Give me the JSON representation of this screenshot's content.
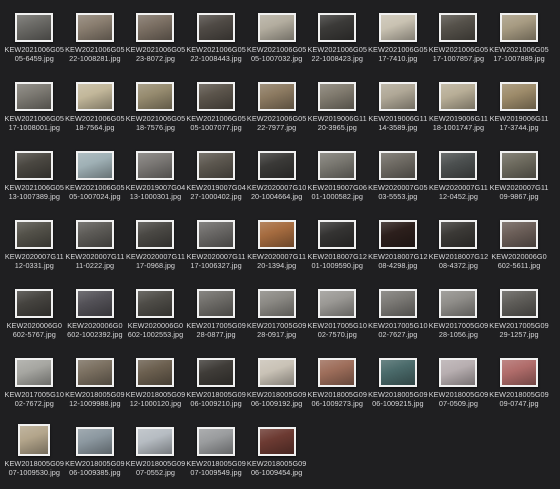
{
  "window": {
    "background": "#1f1f21"
  },
  "files": [
    {
      "name": "KEW20210606G0505-6459.jpg",
      "line1": "KEW2021006G05",
      "line2": "05-6459.jpg",
      "shape": "landscape",
      "tone": "#6b6a66"
    },
    {
      "name": "KEW20210606G0522-1008281.jpg",
      "line1": "KEW2021006G05",
      "line2": "22-1008281.jpg",
      "shape": "landscape",
      "tone": "#8a7e70"
    },
    {
      "name": "KEW20210606G0523-8072.jpg",
      "line1": "KEW2021006G05",
      "line2": "23-8072.jpg",
      "shape": "landscape",
      "tone": "#7c7064"
    },
    {
      "name": "KEW20210606G0522-1008443.jpg",
      "line1": "KEW2021006G05",
      "line2": "22-1008443.jpg",
      "shape": "landscape",
      "tone": "#4f4a45"
    },
    {
      "name": "KEW20210606G0505-1007032.jpg",
      "line1": "KEW2021006G05",
      "line2": "05-1007032.jpg",
      "shape": "landscape",
      "tone": "#b3ad9f"
    },
    {
      "name": "KEW20210606G0522-1008423.jpg",
      "line1": "KEW2021006G05",
      "line2": "22-1008423.jpg",
      "shape": "landscape",
      "tone": "#3b3a38"
    },
    {
      "name": "KEW20210606G0517-7410.jpg",
      "line1": "KEW2021006G05",
      "line2": "17-7410.jpg",
      "shape": "landscape",
      "tone": "#c9c2b2"
    },
    {
      "name": "KEW20210606G0517-1007857.jpg",
      "line1": "KEW2021006G05",
      "line2": "17-1007857.jpg",
      "shape": "landscape",
      "tone": "#55514a"
    },
    {
      "name": "KEW20210606G0517-1007889.jpg",
      "line1": "KEW2021006G05",
      "line2": "17-1007889.jpg",
      "shape": "landscape",
      "tone": "#a79b82"
    },
    {
      "name": "KEW20210606G0517-1008001.jpg",
      "line1": "KEW2021006G05",
      "line2": "17-1008001.jpg",
      "shape": "landscape",
      "tone": "#7d7a73"
    },
    {
      "name": "KEW20210606G0518-7564.jpg",
      "line1": "KEW2021006G05",
      "line2": "18-7564.jpg",
      "shape": "landscape",
      "tone": "#c2b79a"
    },
    {
      "name": "KEW20210606G0518-7576.jpg",
      "line1": "KEW2021006G05",
      "line2": "18-7576.jpg",
      "shape": "landscape",
      "tone": "#968b6f"
    },
    {
      "name": "KEW20210606G0505-1007077.jpg",
      "line1": "KEW2021006G05",
      "line2": "05-1007077.jpg",
      "shape": "landscape",
      "tone": "#5b544b"
    },
    {
      "name": "KEW20210606G0522-7977.jpg",
      "line1": "KEW2021006G05",
      "line2": "22-7977.jpg",
      "shape": "landscape",
      "tone": "#8c7a61"
    },
    {
      "name": "KEW20190606G1120-3965.jpg",
      "line1": "KEW2019006G11",
      "line2": "20-3965.jpg",
      "shape": "landscape",
      "tone": "#817b6f"
    },
    {
      "name": "KEW20190606G1114-3589.jpg",
      "line1": "KEW2019006G11",
      "line2": "14-3589.jpg",
      "shape": "landscape",
      "tone": "#b0a897"
    },
    {
      "name": "KEW20190606G1118-1001747.jpg",
      "line1": "KEW2019006G11",
      "line2": "18-1001747.jpg",
      "shape": "landscape",
      "tone": "#b8ae97"
    },
    {
      "name": "KEW20190606G1117-3744.jpg",
      "line1": "KEW2019006G11",
      "line2": "17-3744.jpg",
      "shape": "landscape",
      "tone": "#9d8b6a"
    },
    {
      "name": "KEW20210606G0513-1007389.jpg",
      "line1": "KEW2021006G05",
      "line2": "13-1007389.jpg",
      "shape": "landscape",
      "tone": "#4a4741"
    },
    {
      "name": "KEW20210606G0505-1007024.jpg",
      "line1": "KEW2021006G05",
      "line2": "05-1007024.jpg",
      "shape": "landscape",
      "tone": "#9fb0b5"
    },
    {
      "name": "KEW20190070G0413-1000301.jpg",
      "line1": "KEW2019007G04",
      "line2": "13-1000301.jpg",
      "shape": "landscape",
      "tone": "#7b7875"
    },
    {
      "name": "KEW20190070G0427-1000402.jpg",
      "line1": "KEW2019007G04",
      "line2": "27-1000402.jpg",
      "shape": "landscape",
      "tone": "#5c574f"
    },
    {
      "name": "KEW20200070G1020-1004664.jpg",
      "line1": "KEW2020007G10",
      "line2": "20-1004664.jpg",
      "shape": "landscape",
      "tone": "#3a3937"
    },
    {
      "name": "KEW20190070G0601-1000582.jpg",
      "line1": "KEW2019007G06",
      "line2": "01-1000582.jpg",
      "shape": "landscape",
      "tone": "#7a7871"
    },
    {
      "name": "KEW20200070G0503-5553.jpg",
      "line1": "KEW2020007G05",
      "line2": "03-5553.jpg",
      "shape": "landscape",
      "tone": "#6e6a63"
    },
    {
      "name": "KEW20200070G1112-0452.jpg",
      "line1": "KEW2020007G11",
      "line2": "12-0452.jpg",
      "shape": "landscape",
      "tone": "#4c5050"
    },
    {
      "name": "KEW20200070G1109-9867.jpg",
      "line1": "KEW2020007G11",
      "line2": "09-9867.jpg",
      "shape": "landscape",
      "tone": "#6d6a5e"
    },
    {
      "name": "KEW20200070G1112-0331.jpg",
      "line1": "KEW2020007G11",
      "line2": "12-0331.jpg",
      "shape": "landscape",
      "tone": "#535149"
    },
    {
      "name": "KEW20200070G1111-0222.jpg",
      "line1": "KEW2020007G11",
      "line2": "11-0222.jpg",
      "shape": "landscape",
      "tone": "#5d5b57"
    },
    {
      "name": "KEW20200070G1117-0968.jpg",
      "line1": "KEW2020007G11",
      "line2": "17-0968.jpg",
      "shape": "landscape",
      "tone": "#4a4844"
    },
    {
      "name": "KEW20200070G1117-1006327.jpg",
      "line1": "KEW2020007G11",
      "line2": "17-1006327.jpg",
      "shape": "landscape",
      "tone": "#6a6866"
    },
    {
      "name": "KEW20200070G1120-1394.jpg",
      "line1": "KEW2020007G11",
      "line2": "20-1394.jpg",
      "shape": "landscape",
      "tone": "#a56b3f"
    },
    {
      "name": "KEW20180070G1201-1009590.jpg",
      "line1": "KEW2018007G12",
      "line2": "01-1009590.jpg",
      "shape": "landscape",
      "tone": "#343332"
    },
    {
      "name": "KEW20180070G1208-4298.jpg",
      "line1": "KEW2018007G12",
      "line2": "08-4298.jpg",
      "shape": "landscape",
      "tone": "#2c1f1c"
    },
    {
      "name": "KEW20180070G1208-4372.jpg",
      "line1": "KEW2018007G12",
      "line2": "08-4372.jpg",
      "shape": "landscape",
      "tone": "#3b3936"
    },
    {
      "name": "KEW20200060G0602-5611.jpg",
      "line1": "KEW2020006G0",
      "line2": "602-5611.jpg",
      "shape": "landscape",
      "tone": "#6b5e58"
    },
    {
      "name": "KEW20200060G0602-5767.jpg",
      "line1": "KEW2020006G0",
      "line2": "602-5767.jpg",
      "shape": "landscape",
      "tone": "#45433f"
    },
    {
      "name": "KEW20200060G0602-1002392.jpg",
      "line1": "KEW2020006G0",
      "line2": "602-1002392.jpg",
      "shape": "landscape",
      "tone": "#535157"
    },
    {
      "name": "KEW20200060G0602-1002553.jpg",
      "line1": "KEW2020006G0",
      "line2": "602-1002553.jpg",
      "shape": "landscape",
      "tone": "#4e4c47"
    },
    {
      "name": "KEW20170050G0928-0877.jpg",
      "line1": "KEW2017005G09",
      "line2": "28-0877.jpg",
      "shape": "landscape",
      "tone": "#6e6c68"
    },
    {
      "name": "KEW20170050G0928-0917.jpg",
      "line1": "KEW2017005G09",
      "line2": "28-0917.jpg",
      "shape": "landscape",
      "tone": "#8a8883"
    },
    {
      "name": "KEW20170050G1002-7570.jpg",
      "line1": "KEW2017005G10",
      "line2": "02-7570.jpg",
      "shape": "landscape",
      "tone": "#9a9894"
    },
    {
      "name": "KEW20170050G1002-7627.jpg",
      "line1": "KEW2017005G10",
      "line2": "02-7627.jpg",
      "shape": "landscape",
      "tone": "#7a7874"
    },
    {
      "name": "KEW20170050G0928-1056.jpg",
      "line1": "KEW2017005G09",
      "line2": "28-1056.jpg",
      "shape": "landscape",
      "tone": "#8f8d89"
    },
    {
      "name": "KEW20170050G0929-1257.jpg",
      "line1": "KEW2017005G09",
      "line2": "29-1257.jpg",
      "shape": "landscape",
      "tone": "#5f5d59"
    },
    {
      "name": "KEW20170050G1002-7672.jpg",
      "line1": "KEW2017005G10",
      "line2": "02-7672.jpg",
      "shape": "landscape",
      "tone": "#a6a6a1"
    },
    {
      "name": "KEW20180050G0912-1009988.jpg",
      "line1": "KEW2018005G09",
      "line2": "12-1009988.jpg",
      "shape": "landscape",
      "tone": "#7a6f60"
    },
    {
      "name": "KEW20180050G0912-1000120.jpg",
      "line1": "KEW2018005G09",
      "line2": "12-1000120.jpg",
      "shape": "landscape",
      "tone": "#6b5f4f"
    },
    {
      "name": "KEW20180050G0906-1009210.jpg",
      "line1": "KEW2018005G09",
      "line2": "06-1009210.jpg",
      "shape": "landscape",
      "tone": "#3f3c38"
    },
    {
      "name": "KEW20180050G0906-1009192.jpg",
      "line1": "KEW2018005G09",
      "line2": "06-1009192.jpg",
      "shape": "landscape",
      "tone": "#c9c2b6"
    },
    {
      "name": "KEW20180050G0906-1009273.jpg",
      "line1": "KEW2018005G09",
      "line2": "06-1009273.jpg",
      "shape": "landscape",
      "tone": "#9d6d5a"
    },
    {
      "name": "KEW20180050G0906-1009215.jpg",
      "line1": "KEW2018005G09",
      "line2": "06-1009215.jpg",
      "shape": "landscape",
      "tone": "#4a6a6a"
    },
    {
      "name": "KEW20180050G0907-0509.jpg",
      "line1": "KEW2018005G09",
      "line2": "07-0509.jpg",
      "shape": "landscape",
      "tone": "#b7aeb0"
    },
    {
      "name": "KEW20180050G0909-0747.jpg",
      "line1": "KEW2018005G09",
      "line2": "09-0747.jpg",
      "shape": "landscape",
      "tone": "#b06c6a"
    },
    {
      "name": "KEW20180050G0907-1009530.jpg",
      "line1": "KEW2018005G09",
      "line2": "07-1009530.jpg",
      "shape": "square",
      "tone": "#b3a58b"
    },
    {
      "name": "KEW20180050G0906-1009385.jpg",
      "line1": "KEW2018005G09",
      "line2": "06-1009385.jpg",
      "shape": "landscape",
      "tone": "#8c98a0"
    },
    {
      "name": "KEW20180050G0907-0552.jpg",
      "line1": "KEW2018005G09",
      "line2": "07-0552.jpg",
      "shape": "landscape",
      "tone": "#b6bcc2"
    },
    {
      "name": "KEW20180050G0907-1009549.jpg",
      "line1": "KEW2018005G09",
      "line2": "07-1009549.jpg",
      "shape": "landscape",
      "tone": "#9a9c9e"
    },
    {
      "name": "KEW20180050G0906-1009454.jpg",
      "line1": "KEW2018005G09",
      "line2": "06-1009454.jpg",
      "shape": "landscape",
      "tone": "#6c3a32"
    }
  ]
}
